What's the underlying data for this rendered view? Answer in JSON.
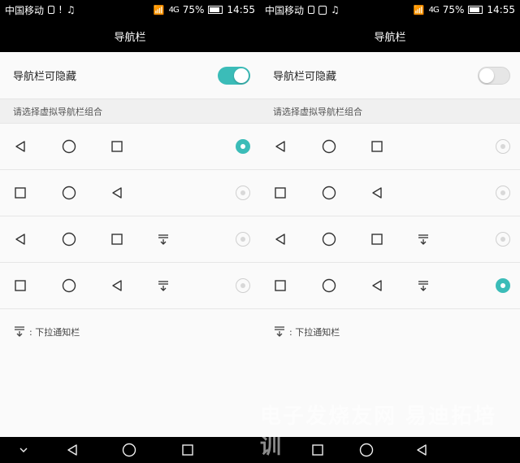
{
  "left": {
    "status": {
      "carrier": "中国移动",
      "network": "4G",
      "battery": "75%",
      "time": "14:55"
    },
    "title": "导航栏",
    "toggle": {
      "label": "导航栏可隐藏",
      "state": "on"
    },
    "section_label": "请选择虚拟导航栏组合",
    "combinations": [
      {
        "icons": [
          "back-triangle-icon",
          "home-circle-icon",
          "recent-square-icon"
        ],
        "selected": true
      },
      {
        "icons": [
          "recent-square-icon",
          "home-circle-icon",
          "back-triangle-icon"
        ],
        "selected": false
      },
      {
        "icons": [
          "back-triangle-icon",
          "home-circle-icon",
          "recent-square-icon",
          "notification-pull-icon"
        ],
        "selected": false
      },
      {
        "icons": [
          "recent-square-icon",
          "home-circle-icon",
          "back-triangle-icon",
          "notification-pull-icon"
        ],
        "selected": false
      }
    ],
    "legend": ": 下拉通知栏",
    "navbar": [
      "chevron-down-icon",
      "back-triangle-icon",
      "home-circle-icon",
      "recent-square-icon"
    ]
  },
  "right": {
    "status": {
      "carrier": "中国移动",
      "network": "4G",
      "battery": "75%",
      "time": "14:55"
    },
    "title": "导航栏",
    "toggle": {
      "label": "导航栏可隐藏",
      "state": "off"
    },
    "section_label": "请选择虚拟导航栏组合",
    "combinations": [
      {
        "icons": [
          "back-triangle-icon",
          "home-circle-icon",
          "recent-square-icon"
        ],
        "selected": false
      },
      {
        "icons": [
          "recent-square-icon",
          "home-circle-icon",
          "back-triangle-icon"
        ],
        "selected": false
      },
      {
        "icons": [
          "back-triangle-icon",
          "home-circle-icon",
          "recent-square-icon",
          "notification-pull-icon"
        ],
        "selected": false
      },
      {
        "icons": [
          "recent-square-icon",
          "home-circle-icon",
          "back-triangle-icon",
          "notification-pull-icon"
        ],
        "selected": true
      }
    ],
    "legend": ": 下拉通知栏",
    "navbar": [
      "recent-square-icon",
      "home-circle-icon",
      "back-triangle-icon"
    ]
  },
  "watermark": "电子发烧友网 易迪拓培训",
  "colors": {
    "accent": "#3bbcb8",
    "bar": "#000000"
  }
}
